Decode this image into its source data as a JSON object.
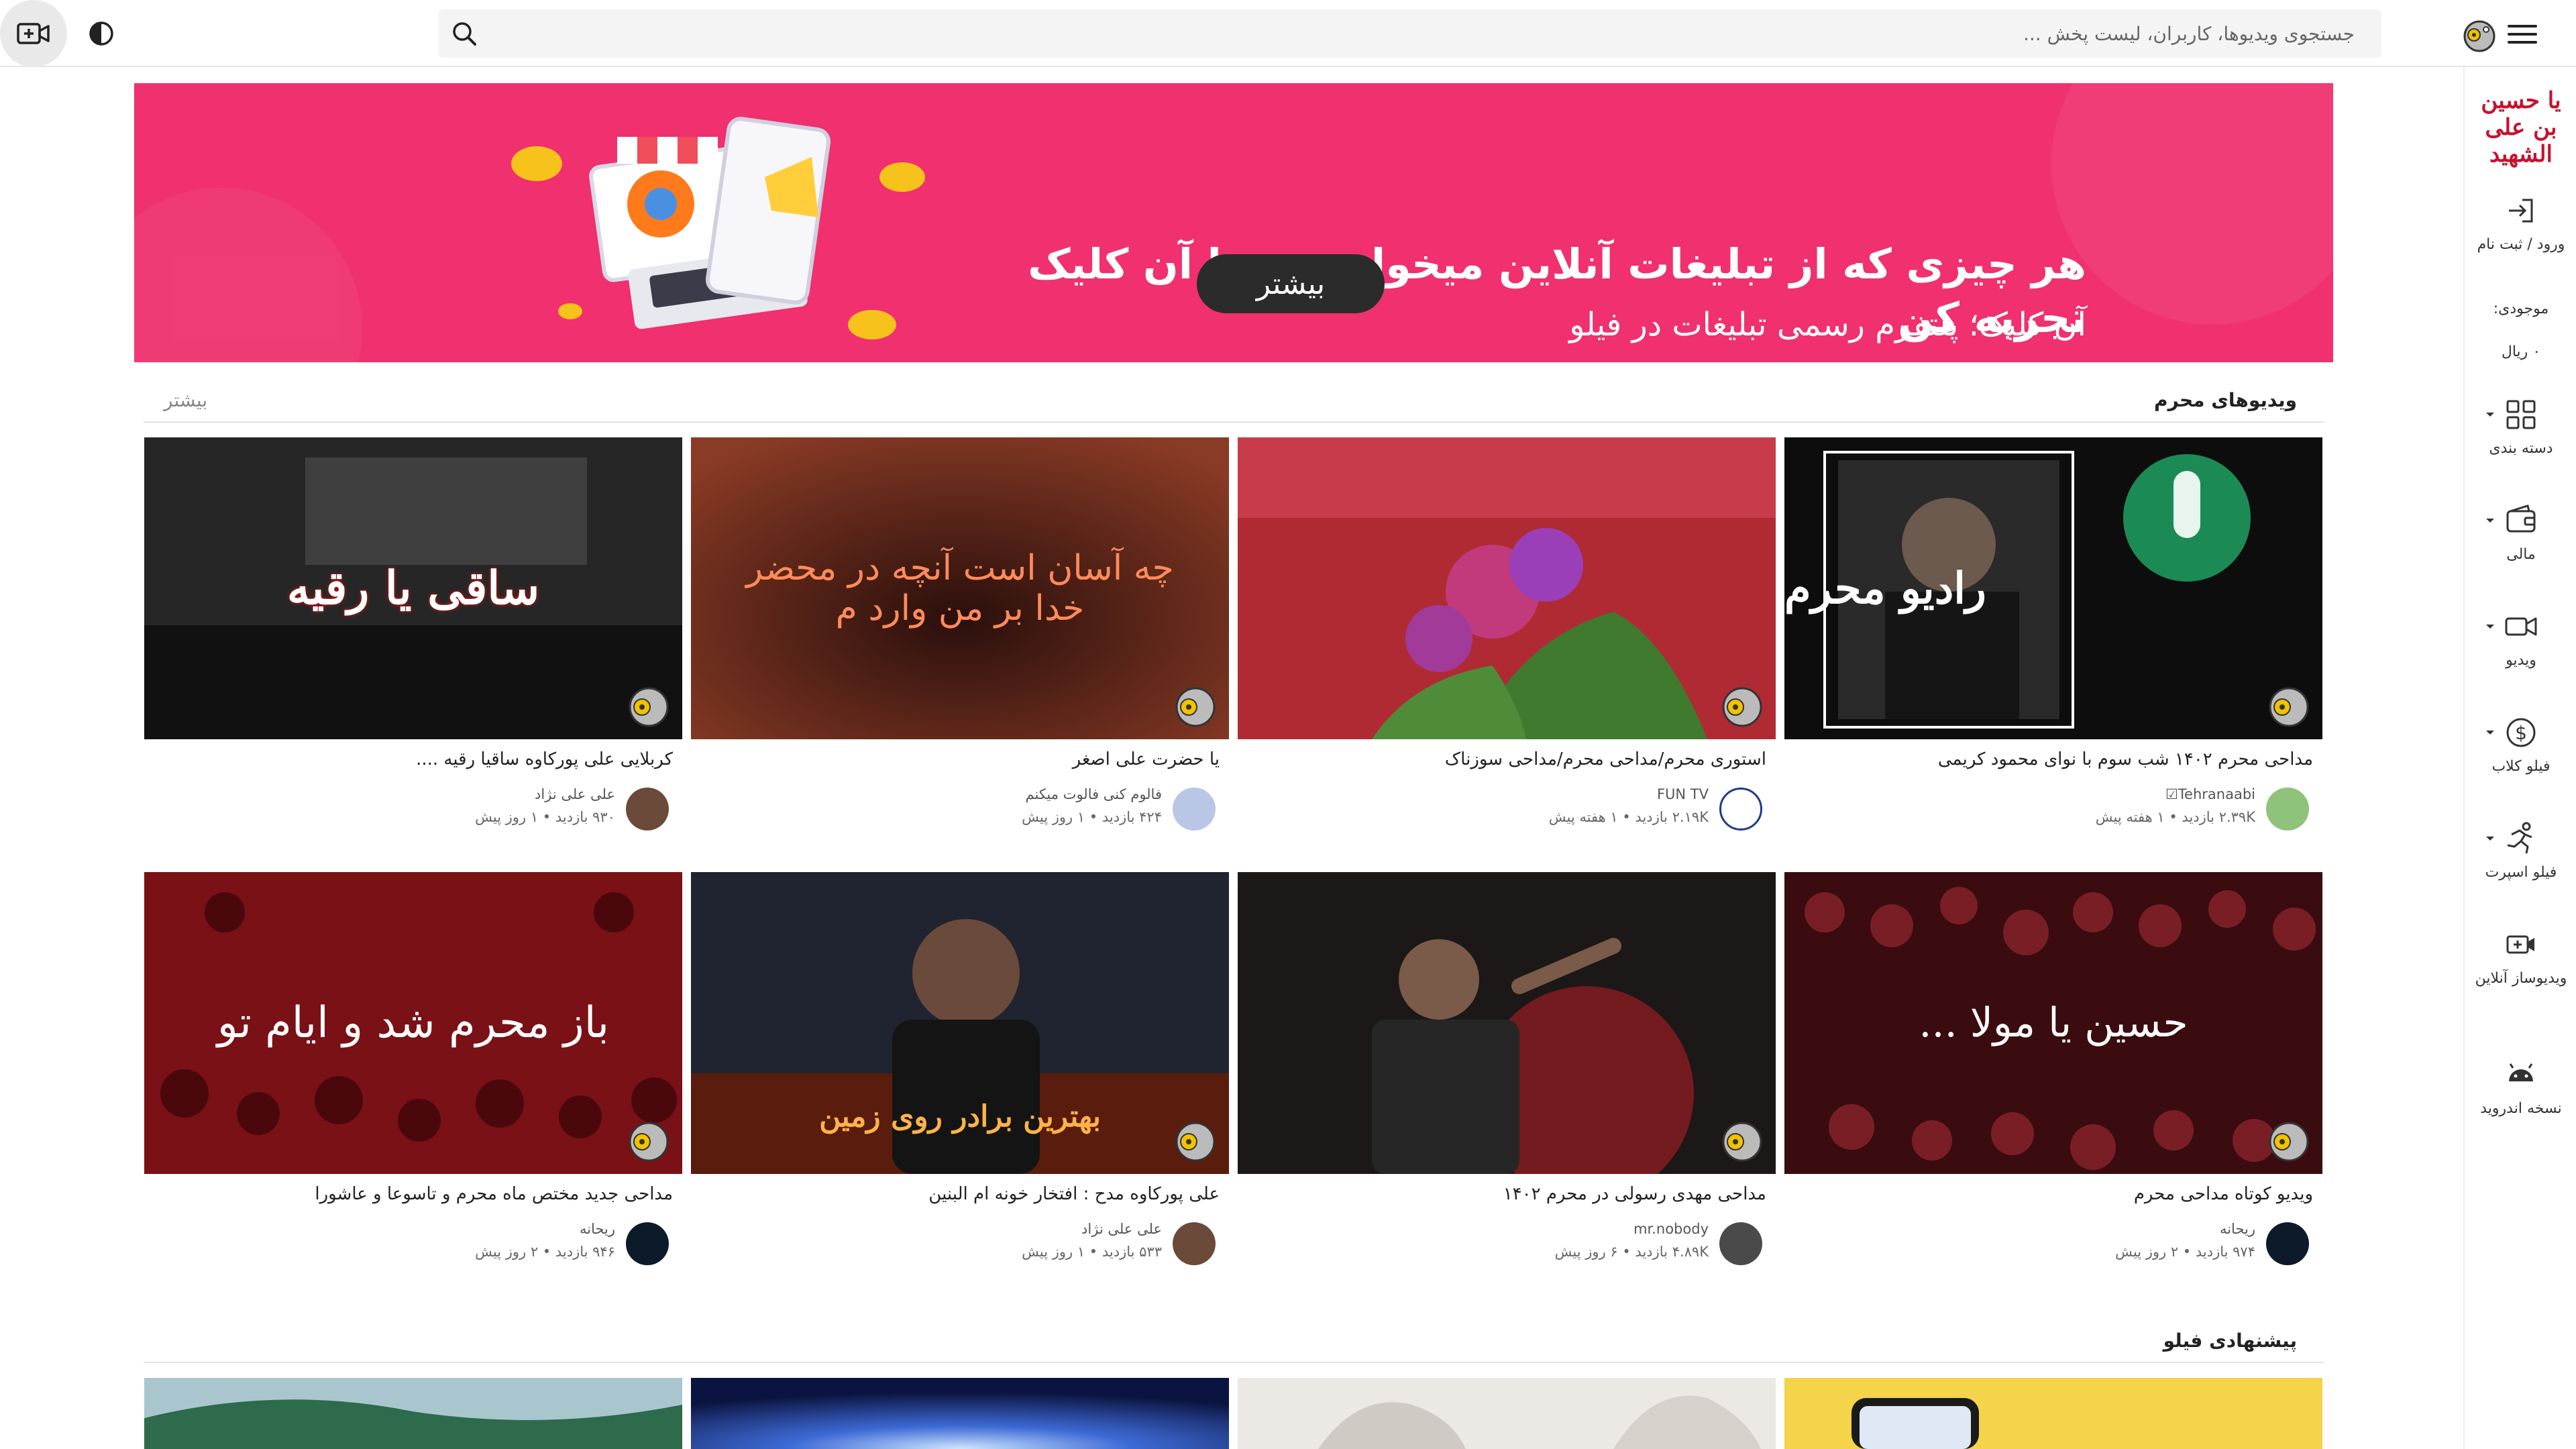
{
  "topbar": {
    "search_placeholder": "جستجوی ویدیوها، کاربران، لیست پخش ...",
    "icons": [
      "camera-plus-icon",
      "contrast-icon",
      "search-icon",
      "hamburger-menu-icon"
    ]
  },
  "sidebar": {
    "logo_text": "یا حسین بن علی الشهید",
    "login_label": "ورود / ثبت نام",
    "balance_label": "موجودی:",
    "balance_value": "۰ ریال",
    "items": [
      {
        "label": "دسته بندی",
        "icon": "grid-icon"
      },
      {
        "label": "مالی",
        "icon": "wallet-icon"
      },
      {
        "label": "ویدیو",
        "icon": "video-camera-icon"
      },
      {
        "label": "فیلو کلاب",
        "icon": "dollar-circle-icon"
      },
      {
        "label": "فیلو اسپرت",
        "icon": "running-person-icon"
      },
      {
        "label": "ویدیوساز آنلاین",
        "icon": "video-maker-icon"
      },
      {
        "label": "نسخه اندروید",
        "icon": "android-icon"
      }
    ]
  },
  "banner": {
    "headline": "هر چیزی که از تبلیغات آنلاین میخوای رو، با آن کلیک تجربه کن",
    "subline": "آن کلیک؛ پلتفرم رسمی تبلیغات در فیلو",
    "cta": "بیشتر",
    "accent": "#f0306f"
  },
  "sections": [
    {
      "title": "ویدیوهای محرم",
      "more": "بیشتر",
      "videos": [
        {
          "title": "مداحی محرم ۱۴۰۲ شب سوم با نوای محمود کریمی",
          "channel": "Tehranaabi☑",
          "views": "۲.۳۹K بازدید",
          "age": "۱ هفته پیش",
          "overlay": "رادیو محرم"
        },
        {
          "title": "استوری محرم/مداحی محرم/مداحی سوزناک",
          "channel": "FUN TV",
          "views": "۲.۱۹K بازدید",
          "age": "۱ هفته پیش",
          "overlay": ""
        },
        {
          "title": "یا حضرت علی اصغر",
          "channel": "فالوم کنی فالوت میکنم",
          "views": "۴۲۴ بازدید",
          "age": "۱ روز پیش",
          "overlay": "چه آسان است آنچه در محضر خدا بر من وارد م"
        },
        {
          "title": "کربلایی علی پورکاوه ساقیا رقیه ....",
          "channel": "علی علی نژاد",
          "views": "۹۳۰ بازدید",
          "age": "۱ روز پیش",
          "overlay": "ساقی یا رقیه"
        },
        {
          "title": "ویدیو کوتاه مداحی محرم",
          "channel": "ریحانه",
          "views": "۹۷۴ بازدید",
          "age": "۲ روز پیش",
          "overlay": "حسین یا مولا ..."
        },
        {
          "title": "مداحی مهدی رسولی در محرم ۱۴۰۲",
          "channel": "mr.nobody",
          "views": "۴.۸۹K بازدید",
          "age": "۶ روز پیش",
          "overlay": ""
        },
        {
          "title": "علی پورکاوه مدح : افتخار خونه ام البنین",
          "channel": "علی علی نژاد",
          "views": "۵۳۳ بازدید",
          "age": "۱ روز پیش",
          "overlay": "بهترین برادر روی زمین"
        },
        {
          "title": "مداحی جدید مختص ماه محرم و تاسوعا و عاشورا",
          "channel": "ریحانه",
          "views": "۹۴۶ بازدید",
          "age": "۲ روز پیش",
          "overlay": "باز محرم شد و ایام تو"
        }
      ]
    },
    {
      "title": "پیشنهادی فیلو",
      "more": "",
      "videos": []
    }
  ],
  "colors": {
    "brand_red": "#c8102e",
    "banner_pink": "#f0306f"
  }
}
